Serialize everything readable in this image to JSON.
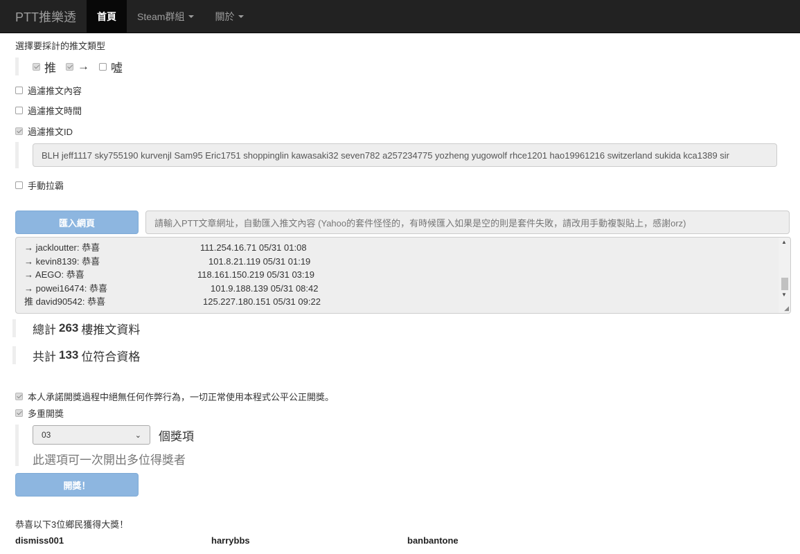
{
  "navbar": {
    "brand": "PTT推樂透",
    "items": [
      {
        "label": "首頁",
        "active": true
      },
      {
        "label": "Steam群組",
        "dropdown": true
      },
      {
        "label": "關於",
        "dropdown": true
      }
    ]
  },
  "push_type": {
    "title": "選擇要採計的推文類型",
    "options": [
      {
        "label": "推",
        "checked": true
      },
      {
        "label": "→",
        "checked": true
      },
      {
        "label": "噓",
        "checked": false
      }
    ]
  },
  "filters": {
    "content": {
      "label": "過濾推文內容",
      "checked": false
    },
    "time": {
      "label": "過濾推文時間",
      "checked": false
    },
    "id": {
      "label": "過濾推文ID",
      "checked": true
    },
    "id_value": "BLH jeff1117 sky755190 kurvenjl Sam95 Eric1751 shoppinglin kawasaki32 seven782 a257234775 yozheng yugowolf rhce1201 hao19961216 switzerland sukida kca1389 sir",
    "manual": {
      "label": "手動拉霸",
      "checked": false
    }
  },
  "import": {
    "button_label": "匯入網頁",
    "url_placeholder": "請輸入PTT文章網址，自動匯入推文內容 (Yahoo的套件怪怪的，有時候匯入如果是空的則是套件失敗，請改用手動複製貼上，感謝orz)"
  },
  "comments": [
    {
      "tag": "→",
      "user": "jackloutter",
      "text": "恭喜",
      "ip": "111.254.16.71",
      "date": "05/31",
      "time": "01:08"
    },
    {
      "tag": "→",
      "user": "kevin8139",
      "text": "恭喜",
      "ip": "101.8.21.119",
      "date": "05/31",
      "time": "01:19"
    },
    {
      "tag": "→",
      "user": "AEGO",
      "text": "恭喜",
      "ip": "118.161.150.219",
      "date": "05/31",
      "time": "03:19"
    },
    {
      "tag": "→",
      "user": "powei16474",
      "text": "恭喜",
      "ip": "101.9.188.139",
      "date": "05/31",
      "time": "08:42"
    },
    {
      "tag": "推",
      "user": "david90542",
      "text": "恭喜",
      "ip": "125.227.180.151",
      "date": "05/31",
      "time": "09:22"
    }
  ],
  "summary": {
    "total_prefix": "總計",
    "total_count": "263",
    "total_suffix": "樓推文資料",
    "qualified_prefix": "共計",
    "qualified_count": "133",
    "qualified_suffix": "位符合資格"
  },
  "promise": {
    "label": "本人承諾開獎過程中絕無任何作弊行為，一切正常使用本程式公平公正開獎。",
    "checked": true
  },
  "multi": {
    "label": "多重開獎",
    "checked": true
  },
  "prize": {
    "selected": "03",
    "suffix": "個獎項",
    "hint": "此選項可一次開出多位得獎者"
  },
  "draw_button": "開獎！",
  "result": {
    "title": "恭喜以下3位鄉民獲得大獎！",
    "winners": [
      "dismiss001",
      "harrybbs",
      "banbantone"
    ]
  },
  "colors": {
    "navbar_bg": "#222222",
    "button_blue": "#8db6e0"
  }
}
